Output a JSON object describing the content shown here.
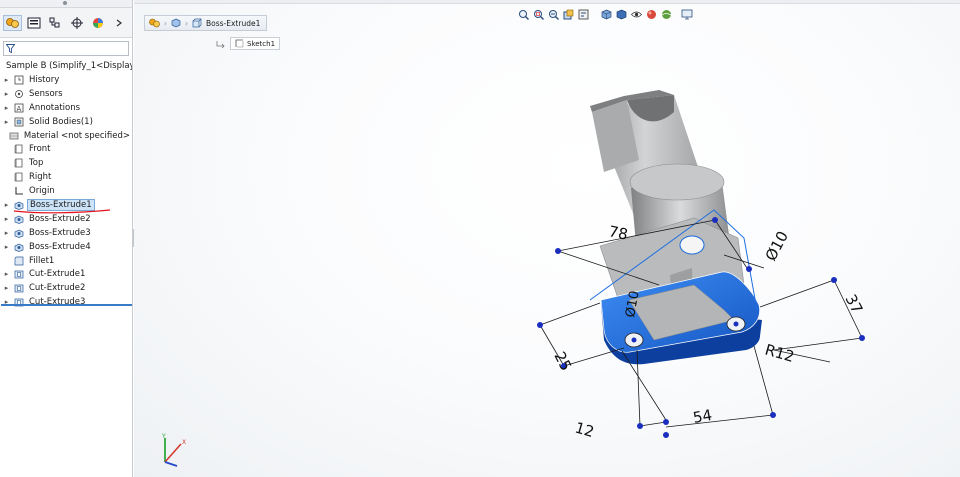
{
  "feature_tree": {
    "root_label": "Sample B  (Simplify_1<Display",
    "items": [
      {
        "label": "History",
        "icon": "history-icon",
        "expandable": true
      },
      {
        "label": "Sensors",
        "icon": "sensors-icon",
        "expandable": true
      },
      {
        "label": "Annotations",
        "icon": "annotations-icon",
        "expandable": true
      },
      {
        "label": "Solid Bodies(1)",
        "icon": "solid-bodies-icon",
        "expandable": true
      },
      {
        "label": "Material <not specified>",
        "icon": "material-icon",
        "expandable": false
      },
      {
        "label": "Front",
        "icon": "plane-icon",
        "expandable": false
      },
      {
        "label": "Top",
        "icon": "plane-icon",
        "expandable": false
      },
      {
        "label": "Right",
        "icon": "plane-icon",
        "expandable": false
      },
      {
        "label": "Origin",
        "icon": "origin-icon",
        "expandable": false
      },
      {
        "label": "Boss-Extrude1",
        "icon": "extrude-icon",
        "expandable": true,
        "selected": true
      },
      {
        "label": "Boss-Extrude2",
        "icon": "extrude-icon",
        "expandable": true
      },
      {
        "label": "Boss-Extrude3",
        "icon": "extrude-icon",
        "expandable": true
      },
      {
        "label": "Boss-Extrude4",
        "icon": "extrude-icon",
        "expandable": true
      },
      {
        "label": "Fillet1",
        "icon": "fillet-icon",
        "expandable": false
      },
      {
        "label": "Cut-Extrude1",
        "icon": "cut-icon",
        "expandable": true
      },
      {
        "label": "Cut-Extrude2",
        "icon": "cut-icon",
        "expandable": true
      },
      {
        "label": "Cut-Extrude3",
        "icon": "cut-icon",
        "expandable": true
      }
    ]
  },
  "breadcrumb": {
    "feature": "Boss-Extrude1",
    "sketch": "Sketch1"
  },
  "dimensions": {
    "d78": "78",
    "d10a": "Ø10",
    "d10b": "Ø10",
    "d37": "37",
    "d25": "25",
    "r12": "R12",
    "d12": "12",
    "d54": "54"
  },
  "triad": {
    "x": "X",
    "y": "Y"
  },
  "colors": {
    "selection_blue": "#1f6fe0",
    "dimension_point": "#1b2fbf",
    "annotation_red": "#e0141e",
    "tree_highlight": "#cde3f7",
    "model_gray": "#b9bbbd"
  }
}
